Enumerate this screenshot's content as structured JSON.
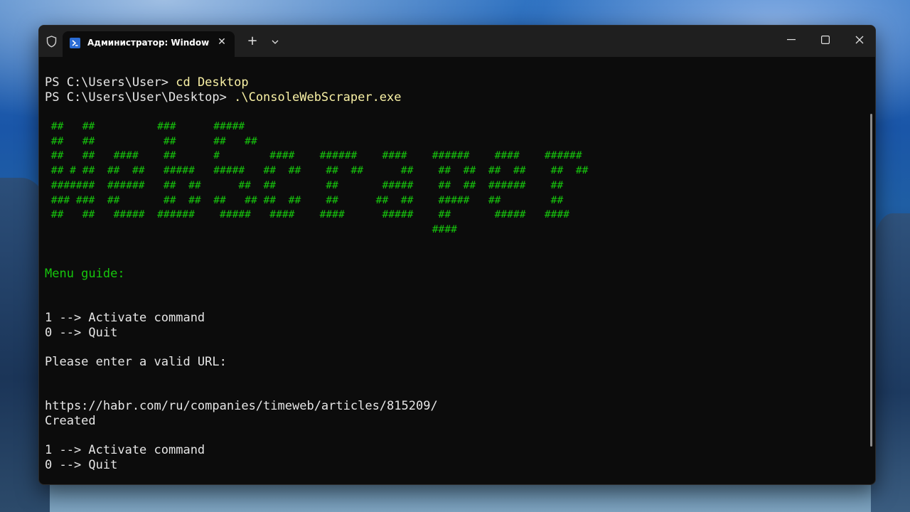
{
  "window": {
    "tab_title": "Администратор: Windows Pc",
    "tab_icon": "powershell-icon",
    "shield_icon": "shield-icon",
    "close_tab_glyph": "✕",
    "new_tab_glyph": "+",
    "minimize_glyph": "—",
    "maximize_glyph": "▢",
    "close_glyph": "✕"
  },
  "console": {
    "cmd1_prompt": "PS C:\\Users\\User> ",
    "cmd1_text": "cd Desktop",
    "cmd2_prompt": "PS C:\\Users\\User\\Desktop> ",
    "cmd2_text": ".\\ConsoleWebScraper.exe",
    "banner": [
      " ##   ##          ###      #####",
      " ##   ##           ##      ##   ##",
      " ##   ##   ####    ##      #        ####    ######    ####    ######    ####    ######",
      " ## # ##  ##  ##   #####   #####   ##  ##    ##  ##      ##    ##  ##  ##  ##    ##  ##",
      " #######  ######   ##  ##      ##  ##        ##       #####    ##  ##  ######    ##",
      " ### ###  ##       ##  ##  ##   ## ##  ##    ##      ##  ##    #####   ##        ##",
      " ##   ##   #####  ######    #####   ####    ####      #####    ##       #####   ####",
      "                                                              ####"
    ],
    "menu_guide": "Menu guide:",
    "menu1_activate": "1 --> Activate command",
    "menu1_quit": "0 --> Quit",
    "prompt_url": "Please enter a valid URL:",
    "url": "https://habr.com/ru/companies/timeweb/articles/815209/",
    "created": "Created",
    "menu2_activate": "1 --> Activate command",
    "menu2_quit": "0 --> Quit"
  },
  "colors": {
    "accent_green": "#16c60c",
    "command_yellow": "#f9f1a5",
    "text": "#e6e6e6",
    "background": "#0c0c0c"
  }
}
